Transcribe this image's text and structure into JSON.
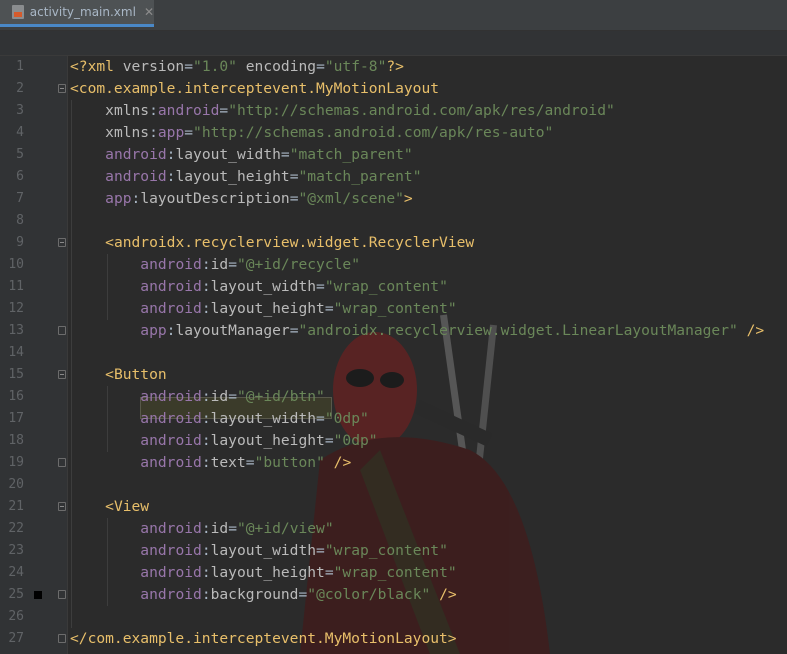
{
  "tab": {
    "filename": "activity_main.xml",
    "close": "✕"
  },
  "lines": [
    {
      "n": "1",
      "segments": [
        [
          "tag",
          "<?xml "
        ],
        [
          "attr",
          "version"
        ],
        [
          "plain",
          "="
        ],
        [
          "val",
          "\"1.0\""
        ],
        [
          "plain",
          " "
        ],
        [
          "attr",
          "encoding"
        ],
        [
          "plain",
          "="
        ],
        [
          "val",
          "\"utf-8\""
        ],
        [
          "tag",
          "?>"
        ]
      ]
    },
    {
      "n": "2",
      "segments": [
        [
          "tag",
          "<com.example.interceptevent.MyMotionLayout"
        ]
      ]
    },
    {
      "n": "3",
      "segments": [
        [
          "plain",
          "    "
        ],
        [
          "attr",
          "xmlns"
        ],
        [
          "plain",
          ":"
        ],
        [
          "ns",
          "android"
        ],
        [
          "plain",
          "="
        ],
        [
          "val",
          "\"http://schemas.android.com/apk/res/android\""
        ]
      ]
    },
    {
      "n": "4",
      "segments": [
        [
          "plain",
          "    "
        ],
        [
          "attr",
          "xmlns"
        ],
        [
          "plain",
          ":"
        ],
        [
          "ns",
          "app"
        ],
        [
          "plain",
          "="
        ],
        [
          "val",
          "\"http://schemas.android.com/apk/res-auto\""
        ]
      ]
    },
    {
      "n": "5",
      "segments": [
        [
          "plain",
          "    "
        ],
        [
          "ns",
          "android"
        ],
        [
          "plain",
          ":"
        ],
        [
          "attr",
          "layout_width"
        ],
        [
          "plain",
          "="
        ],
        [
          "val",
          "\"match_parent\""
        ]
      ]
    },
    {
      "n": "6",
      "segments": [
        [
          "plain",
          "    "
        ],
        [
          "ns",
          "android"
        ],
        [
          "plain",
          ":"
        ],
        [
          "attr",
          "layout_height"
        ],
        [
          "plain",
          "="
        ],
        [
          "val",
          "\"match_parent\""
        ]
      ]
    },
    {
      "n": "7",
      "segments": [
        [
          "plain",
          "    "
        ],
        [
          "ns",
          "app"
        ],
        [
          "plain",
          ":"
        ],
        [
          "attr",
          "layoutDescription"
        ],
        [
          "plain",
          "="
        ],
        [
          "val",
          "\"@xml/scene\""
        ],
        [
          "tag",
          ">"
        ]
      ]
    },
    {
      "n": "8",
      "segments": []
    },
    {
      "n": "9",
      "segments": [
        [
          "plain",
          "    "
        ],
        [
          "tag",
          "<androidx.recyclerview.widget.RecyclerView"
        ]
      ]
    },
    {
      "n": "10",
      "segments": [
        [
          "plain",
          "        "
        ],
        [
          "ns",
          "android"
        ],
        [
          "plain",
          ":"
        ],
        [
          "attr",
          "id"
        ],
        [
          "plain",
          "="
        ],
        [
          "val",
          "\"@+id/recycle\""
        ]
      ]
    },
    {
      "n": "11",
      "segments": [
        [
          "plain",
          "        "
        ],
        [
          "ns",
          "android"
        ],
        [
          "plain",
          ":"
        ],
        [
          "attr",
          "layout_width"
        ],
        [
          "plain",
          "="
        ],
        [
          "val",
          "\"wrap_content\""
        ]
      ]
    },
    {
      "n": "12",
      "segments": [
        [
          "plain",
          "        "
        ],
        [
          "ns",
          "android"
        ],
        [
          "plain",
          ":"
        ],
        [
          "attr",
          "layout_height"
        ],
        [
          "plain",
          "="
        ],
        [
          "val",
          "\"wrap_content\""
        ]
      ]
    },
    {
      "n": "13",
      "segments": [
        [
          "plain",
          "        "
        ],
        [
          "ns",
          "app"
        ],
        [
          "plain",
          ":"
        ],
        [
          "attr",
          "layoutManager"
        ],
        [
          "plain",
          "="
        ],
        [
          "val",
          "\"androidx.recyclerview.widget.LinearLayoutManager\""
        ],
        [
          "plain",
          " "
        ],
        [
          "tag",
          "/>"
        ]
      ]
    },
    {
      "n": "14",
      "segments": []
    },
    {
      "n": "15",
      "segments": [
        [
          "plain",
          "    "
        ],
        [
          "tag",
          "<Button"
        ]
      ]
    },
    {
      "n": "16",
      "segments": [
        [
          "plain",
          "        "
        ],
        [
          "ns",
          "android"
        ],
        [
          "plain",
          ":"
        ],
        [
          "attr",
          "id"
        ],
        [
          "plain",
          "="
        ],
        [
          "val",
          "\"@+id/btn\""
        ]
      ]
    },
    {
      "n": "17",
      "segments": [
        [
          "plain",
          "        "
        ],
        [
          "ns",
          "android"
        ],
        [
          "plain",
          ":"
        ],
        [
          "attr",
          "layout_width"
        ],
        [
          "plain",
          "="
        ],
        [
          "val",
          "\"0dp\""
        ]
      ]
    },
    {
      "n": "18",
      "segments": [
        [
          "plain",
          "        "
        ],
        [
          "ns",
          "android"
        ],
        [
          "plain",
          ":"
        ],
        [
          "attr",
          "layout_height"
        ],
        [
          "plain",
          "="
        ],
        [
          "val",
          "\"0dp\""
        ]
      ]
    },
    {
      "n": "19",
      "segments": [
        [
          "plain",
          "        "
        ],
        [
          "ns",
          "android"
        ],
        [
          "plain",
          ":"
        ],
        [
          "attr",
          "text"
        ],
        [
          "plain",
          "="
        ],
        [
          "val",
          "\"button\""
        ],
        [
          "plain",
          " "
        ],
        [
          "tag",
          "/>"
        ]
      ]
    },
    {
      "n": "20",
      "segments": []
    },
    {
      "n": "21",
      "segments": [
        [
          "plain",
          "    "
        ],
        [
          "tag",
          "<View"
        ]
      ]
    },
    {
      "n": "22",
      "segments": [
        [
          "plain",
          "        "
        ],
        [
          "ns",
          "android"
        ],
        [
          "plain",
          ":"
        ],
        [
          "attr",
          "id"
        ],
        [
          "plain",
          "="
        ],
        [
          "val",
          "\"@+id/view\""
        ]
      ]
    },
    {
      "n": "23",
      "segments": [
        [
          "plain",
          "        "
        ],
        [
          "ns",
          "android"
        ],
        [
          "plain",
          ":"
        ],
        [
          "attr",
          "layout_width"
        ],
        [
          "plain",
          "="
        ],
        [
          "val",
          "\"wrap_content\""
        ]
      ]
    },
    {
      "n": "24",
      "segments": [
        [
          "plain",
          "        "
        ],
        [
          "ns",
          "android"
        ],
        [
          "plain",
          ":"
        ],
        [
          "attr",
          "layout_height"
        ],
        [
          "plain",
          "="
        ],
        [
          "val",
          "\"wrap_content\""
        ]
      ]
    },
    {
      "n": "25",
      "segments": [
        [
          "plain",
          "        "
        ],
        [
          "ns",
          "android"
        ],
        [
          "plain",
          ":"
        ],
        [
          "attr",
          "background"
        ],
        [
          "plain",
          "="
        ],
        [
          "val",
          "\"@color/black\""
        ],
        [
          "plain",
          " "
        ],
        [
          "tag",
          "/>"
        ]
      ]
    },
    {
      "n": "26",
      "segments": []
    },
    {
      "n": "27",
      "segments": [
        [
          "tag",
          "</com.example.interceptevent.MyMotionLayout>"
        ]
      ]
    }
  ],
  "folds": {
    "2": "open",
    "9": "open",
    "13": "close",
    "15": "open",
    "19": "close",
    "21": "open",
    "25": "close",
    "27": "close"
  },
  "markers": [
    "25"
  ],
  "colors": {
    "tag": "#e8bf6a",
    "ns": "#9876aa",
    "attr": "#bababa",
    "val": "#6a8759",
    "plain": "#a9b7c6",
    "accent": "#4a88c7"
  },
  "icons": {
    "tab_icon": "xml-file-icon",
    "fold": "fold-marker-icon",
    "bookmark": "bookmark-icon",
    "background": "deadpool-wallpaper"
  }
}
